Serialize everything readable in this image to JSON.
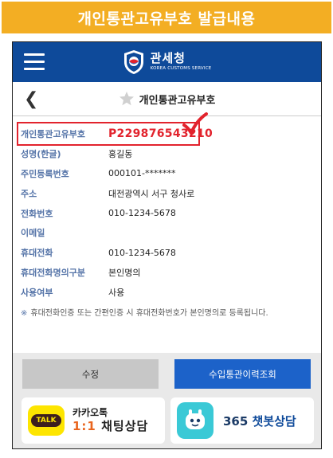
{
  "banner": {
    "title": "개인통관고유부호 발급내용"
  },
  "appbar": {
    "brand_name": "관세청",
    "brand_sub": "KOREA CUSTOMS SERVICE"
  },
  "subheader": {
    "title": "개인통관고유부호"
  },
  "info": {
    "rows": [
      {
        "label": "개인통관고유부호",
        "value": "P229876543210"
      },
      {
        "label": "성명(한글)",
        "value": "홍길동"
      },
      {
        "label": "주민등록번호",
        "value": "000101-*******"
      },
      {
        "label": "주소",
        "value": "대전광역시 서구 청사로"
      },
      {
        "label": "전화번호",
        "value": "010-1234-5678"
      },
      {
        "label": "이메일",
        "value": ""
      },
      {
        "label": "휴대전화",
        "value": "010-1234-5678"
      },
      {
        "label": "휴대전화명의구분",
        "value": "본인명의"
      },
      {
        "label": "사용여부",
        "value": "사용"
      }
    ]
  },
  "note": {
    "mark": "※",
    "text": "휴대전화인증 또는 간편인증 시 휴대전화번호가 본인명의로 등록됩니다."
  },
  "buttons": {
    "edit": "수정",
    "history": "수입통관이력조회"
  },
  "chat": {
    "kakao_icon_text": "TALK",
    "kakao_top": "카카오톡",
    "kakao_num": "1:1",
    "kakao_rest": " 채팅상담",
    "bot_num": "365",
    "bot_rest": " 챗봇상담"
  },
  "colors": {
    "banner": "#f3ae23",
    "appbar": "#0e4a9a",
    "highlight": "#e2232d",
    "label": "#5574a8",
    "primary_button": "#1c62c9"
  },
  "icons": [
    "hamburger-icon",
    "customs-logo-icon",
    "back-arrow-icon",
    "star-icon",
    "checkmark-icon",
    "kakao-talk-icon",
    "chatbot-icon"
  ]
}
